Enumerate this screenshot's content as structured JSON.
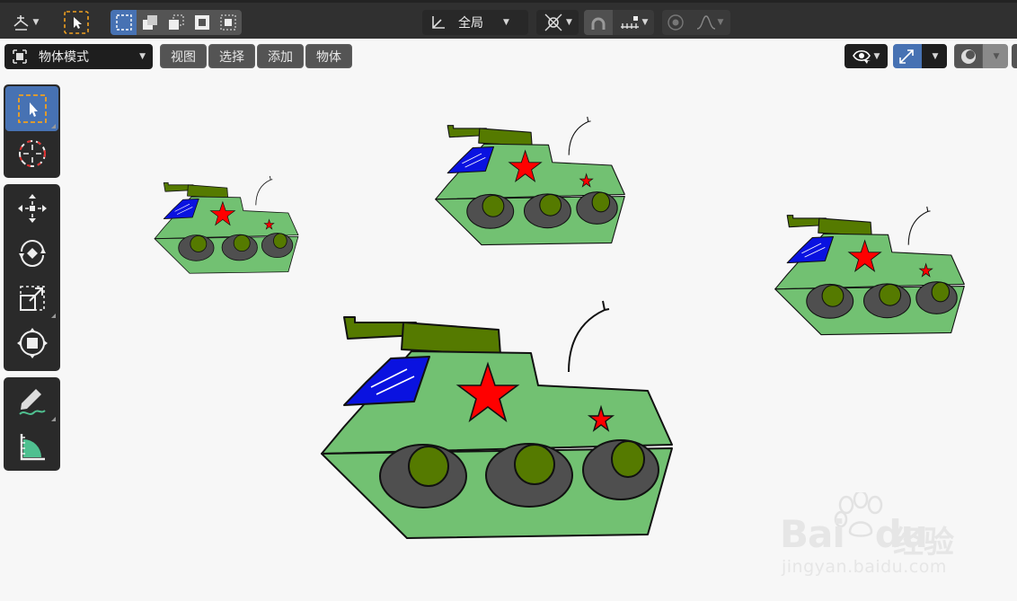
{
  "toolbar": {
    "orientation_value": "全局",
    "orientation_icon": "transform-orientation-icon",
    "pivot_icon": "pivot-point-icon",
    "snap_icon": "snap-icon",
    "proportional_icon": "proportional-editing-icon"
  },
  "header": {
    "mode_label": "物体模式",
    "menus": [
      "视图",
      "选择",
      "添加",
      "物体"
    ]
  },
  "tools": [
    "select-box",
    "cursor",
    "move",
    "rotate",
    "scale",
    "transform",
    "annotate",
    "measure"
  ],
  "watermark": {
    "brand": "Bai",
    "brand2": "du",
    "brand_cn": "经验",
    "url": "jingyan.baidu.com"
  },
  "colors": {
    "accent": "#4772b3",
    "tank_body": "#72c172",
    "turret": "#557a00",
    "wheel": "#4f4f4f",
    "hub": "#557a00",
    "window": "#0a12e0",
    "star": "#ff0000"
  }
}
